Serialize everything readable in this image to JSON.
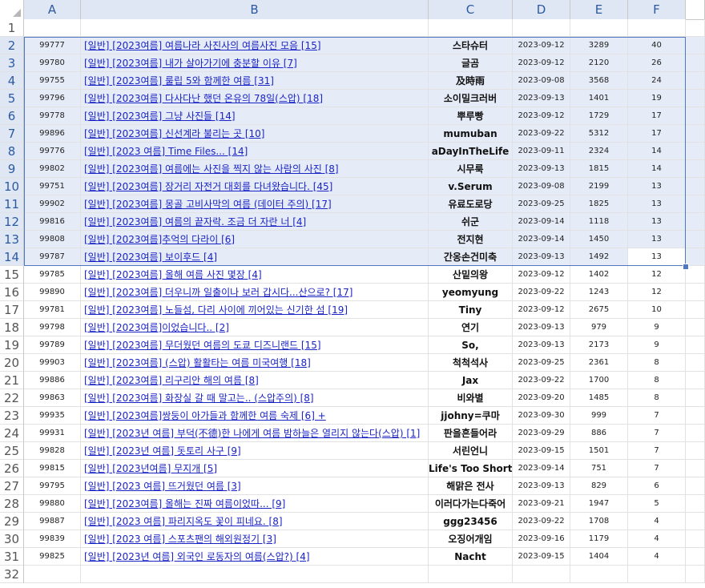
{
  "columns": [
    "A",
    "B",
    "C",
    "D",
    "E",
    "F"
  ],
  "selection": {
    "rows_from": 2,
    "rows_to": 14
  },
  "rows": [
    {
      "n": "1",
      "cells": [
        "",
        "",
        "",
        "",
        "",
        ""
      ]
    },
    {
      "n": "2",
      "cells": [
        "99777",
        "[일반] [2023여름] 여름나라 사진사의 여름사진 모음 [15]",
        "스타슈터",
        "2023-09-12",
        "3289",
        "40"
      ]
    },
    {
      "n": "3",
      "cells": [
        "99780",
        "[일반] [2023여름] 내가 살아가기에 충분할 이유 [7]",
        "글곰",
        "2023-09-12",
        "2120",
        "26"
      ]
    },
    {
      "n": "4",
      "cells": [
        "99755",
        "[일반] [2023여름] 룰립 5와 함께한 여름 [31]",
        "及時雨",
        "2023-09-08",
        "3568",
        "24"
      ]
    },
    {
      "n": "5",
      "cells": [
        "99796",
        "[일반] [2023여름] 다사다난 했던 온유의 78일(스압) [18]",
        "소이밀크러버",
        "2023-09-13",
        "1401",
        "19"
      ]
    },
    {
      "n": "6",
      "cells": [
        "99778",
        "[일반] [2023여름] 그냥 사진들 [14]",
        "뿌루빵",
        "2023-09-12",
        "1729",
        "17"
      ]
    },
    {
      "n": "7",
      "cells": [
        "99896",
        "[일반] [2023여름] 신선계라 불리는 곳 [10]",
        "mumuban",
        "2023-09-22",
        "5312",
        "17"
      ]
    },
    {
      "n": "8",
      "cells": [
        "99776",
        "[일반] [2023 여름] Time Files... [14]",
        "aDayInTheLife",
        "2023-09-11",
        "2324",
        "14"
      ]
    },
    {
      "n": "9",
      "cells": [
        "99802",
        "[일반] [2023여름] 여름에는 사진을 찍지 않는 사람의 사진 [8]",
        "시무룩",
        "2023-09-13",
        "1815",
        "14"
      ]
    },
    {
      "n": "10",
      "cells": [
        "99751",
        "[일반] [2023여름] 장거리 자전거 대회를 다녀왔습니다. [45]",
        "v.Serum",
        "2023-09-08",
        "2199",
        "13"
      ]
    },
    {
      "n": "11",
      "cells": [
        "99902",
        "[일반] [2023여름] 몽골 고비사막의 여름 (데이터 주의) [17]",
        "유료도로당",
        "2023-09-25",
        "1825",
        "13"
      ]
    },
    {
      "n": "12",
      "cells": [
        "99816",
        "[일반] [2023여름] 여름의 끝자락. 조금 더 자란 너 [4]",
        "쉬군",
        "2023-09-14",
        "1118",
        "13"
      ]
    },
    {
      "n": "13",
      "cells": [
        "99808",
        "[일반] [2023여름]추억의 다라이 [6]",
        "전지현",
        "2023-09-14",
        "1450",
        "13"
      ]
    },
    {
      "n": "14",
      "cells": [
        "99787",
        "[일반] [2023여름] 보이후드 [4]",
        "간옹손건미축",
        "2023-09-13",
        "1492",
        "13"
      ]
    },
    {
      "n": "15",
      "cells": [
        "99785",
        "[일반] [2023여름] 올해 여름 사진 몇장 [4]",
        "산밑의왕",
        "2023-09-12",
        "1402",
        "12"
      ]
    },
    {
      "n": "16",
      "cells": [
        "99890",
        "[일반] [2023여름] 더우니까 일출이나 보러 갑시다...산으로? [17]",
        "yeomyung",
        "2023-09-22",
        "1243",
        "12"
      ]
    },
    {
      "n": "17",
      "cells": [
        "99781",
        "[일반] [2023여름] 노들섬, 다리 사이에 끼어있는 신기한 섬 [19]",
        "Tiny",
        "2023-09-12",
        "2675",
        "10"
      ]
    },
    {
      "n": "18",
      "cells": [
        "99798",
        "[일반] [2023여름]이었습니다.. [2]",
        "연기",
        "2023-09-13",
        "979",
        "9"
      ]
    },
    {
      "n": "19",
      "cells": [
        "99789",
        "[일반] [2023여름] 무더웠던 여름의 도쿄 디즈니랜드 [15]",
        "So,",
        "2023-09-13",
        "2173",
        "9"
      ]
    },
    {
      "n": "20",
      "cells": [
        "99903",
        "[일반] [2023여름] (스압) 활활타는 여름 미국여행 [18]",
        "척척석사",
        "2023-09-25",
        "2361",
        "8"
      ]
    },
    {
      "n": "21",
      "cells": [
        "99886",
        "[일반] [2023여름] 리구리안 해의 여름 [8]",
        "Jax",
        "2023-09-22",
        "1700",
        "8"
      ]
    },
    {
      "n": "22",
      "cells": [
        "99863",
        "[일반] [2023여름] 화장실 갈 때 말고는.. (스압주의) [8]",
        "비와별",
        "2023-09-20",
        "1485",
        "8"
      ]
    },
    {
      "n": "23",
      "cells": [
        "99935",
        "[일반] [2023여름]쌍둥이 아가들과 함께한 여름 숙제 [6] +",
        "jjohny=쿠마",
        "2023-09-30",
        "999",
        "7"
      ]
    },
    {
      "n": "24",
      "cells": [
        "99931",
        "[일반] [2023년 여름] 부덕(不德)한 나에게 여름 밤하늘은 열리지 않는다(스압) [1]",
        "판을흔들어라",
        "2023-09-29",
        "886",
        "7"
      ]
    },
    {
      "n": "25",
      "cells": [
        "99828",
        "[일반] [2023년 여름] 돗토리 사구 [9]",
        "서린언니",
        "2023-09-15",
        "1501",
        "7"
      ]
    },
    {
      "n": "26",
      "cells": [
        "99815",
        "[일반] [2023년여름] 무지개 [5]",
        "Life's Too Short",
        "2023-09-14",
        "751",
        "7"
      ]
    },
    {
      "n": "27",
      "cells": [
        "99795",
        "[일반] [2023 여름] 뜨거웠던 여름 [3]",
        "해맑은 전사",
        "2023-09-13",
        "829",
        "6"
      ]
    },
    {
      "n": "28",
      "cells": [
        "99880",
        "[일반] [2023여름] 올해는 진짜 여름이었따... [9]",
        "이러다가는다죽어",
        "2023-09-21",
        "1947",
        "5"
      ]
    },
    {
      "n": "29",
      "cells": [
        "99887",
        "[일반] [2023 여름] 파리지옥도 꽃이 피네요. [8]",
        "ggg23456",
        "2023-09-22",
        "1708",
        "4"
      ]
    },
    {
      "n": "30",
      "cells": [
        "99839",
        "[일반] [2023 여름] 스포츠팬의 해외원정기 [3]",
        "오징어개임",
        "2023-09-16",
        "1179",
        "4"
      ]
    },
    {
      "n": "31",
      "cells": [
        "99825",
        "[일반] [2023년 여름] 외국인 로동자의 여름(스압?) [4]",
        "Nacht",
        "2023-09-15",
        "1404",
        "4"
      ]
    },
    {
      "n": "32",
      "cells": [
        "",
        "",
        "",
        "",
        "",
        ""
      ]
    }
  ]
}
